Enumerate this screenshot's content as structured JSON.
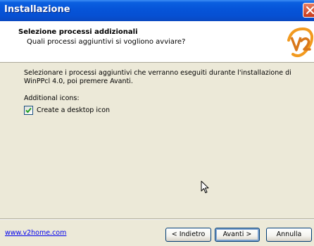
{
  "window": {
    "title": "Installazione",
    "close_icon": "close-icon"
  },
  "header": {
    "title": "Selezione processi addizionali",
    "subtitle": "Quali processi aggiuntivi si vogliono avviare?",
    "logo_icon": "v2-logo"
  },
  "content": {
    "description": "Selezionare i processi aggiuntivi che verranno eseguiti durante l'installazione di WinPPcl 4.0, poi premere Avanti.",
    "group_label": "Additional icons:",
    "tasks": [
      {
        "label": "Create a desktop icon",
        "checked": true
      }
    ]
  },
  "footer": {
    "link": "www.v2home.com",
    "back_label": "< Indietro",
    "next_label": "Avanti >",
    "cancel_label": "Annulla"
  },
  "colors": {
    "titlebar": "#0654d8",
    "dialog_background": "#ece9d8",
    "header_background": "#ffffff",
    "logo_orange": "#f29a1f",
    "link": "#0000ee"
  }
}
